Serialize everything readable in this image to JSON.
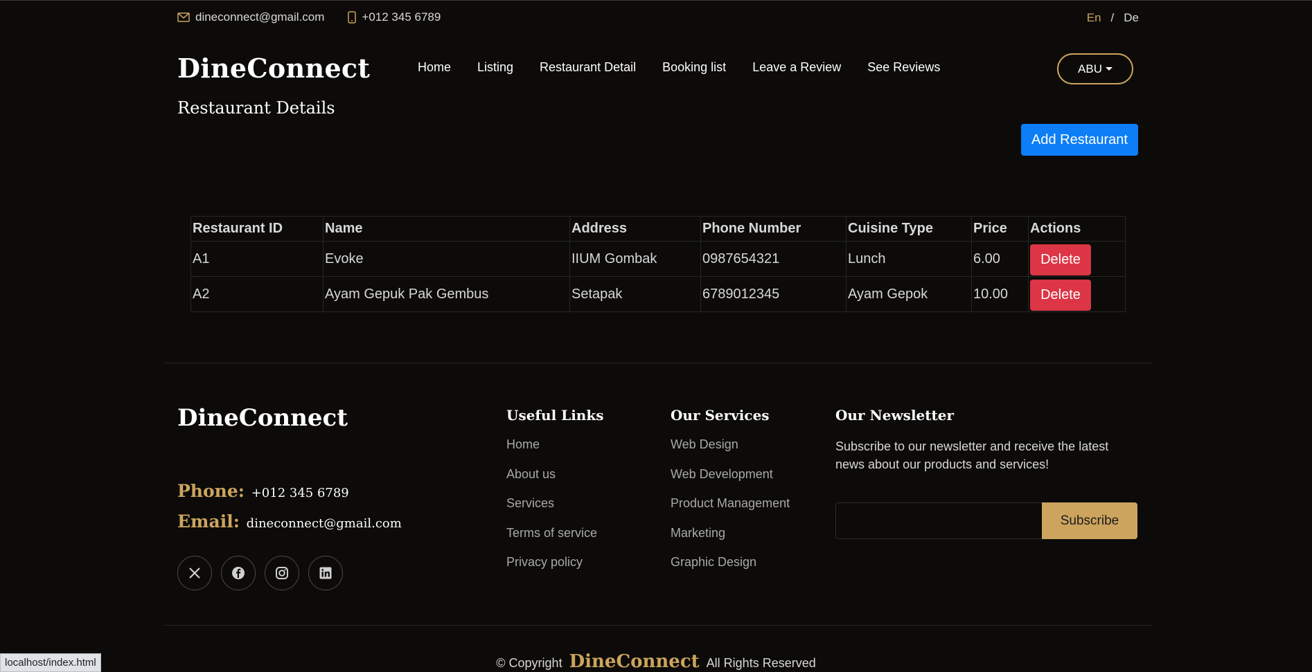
{
  "topbar": {
    "email": "dineconnect@gmail.com",
    "phone": "+012 345 6789",
    "lang_en": "En",
    "lang_sep": "/",
    "lang_de": "De"
  },
  "header": {
    "logo": "DineConnect",
    "nav": [
      "Home",
      "Listing",
      "Restaurant Detail",
      "Booking list",
      "Leave a Review",
      "See Reviews"
    ],
    "user_label": "ABU"
  },
  "main": {
    "title": "Restaurant Details",
    "add_button": "Add Restaurant",
    "columns": [
      "Restaurant ID",
      "Name",
      "Address",
      "Phone Number",
      "Cuisine Type",
      "Price",
      "Actions"
    ],
    "rows": [
      {
        "id": "A1",
        "name": "Evoke",
        "address": "IIUM Gombak",
        "phone": "0987654321",
        "cuisine": "Lunch",
        "price": "6.00",
        "action": "Delete"
      },
      {
        "id": "A2",
        "name": "Ayam Gepuk Pak Gembus",
        "address": "Setapak",
        "phone": "6789012345",
        "cuisine": "Ayam Gepok",
        "price": "10.00",
        "action": "Delete"
      }
    ]
  },
  "footer": {
    "logo": "DineConnect",
    "phone_label": "Phone:",
    "phone_value": "+012 345 6789",
    "email_label": "Email:",
    "email_value": "dineconnect@gmail.com",
    "socials": [
      "x-icon",
      "facebook-icon",
      "instagram-icon",
      "linkedin-icon"
    ],
    "useful_links": {
      "title": "Useful Links",
      "items": [
        "Home",
        "About us",
        "Services",
        "Terms of service",
        "Privacy policy"
      ]
    },
    "services": {
      "title": "Our Services",
      "items": [
        "Web Design",
        "Web Development",
        "Product Management",
        "Marketing",
        "Graphic Design"
      ]
    },
    "newsletter": {
      "title": "Our Newsletter",
      "text": "Subscribe to our newsletter and receive the latest news about our products and services!",
      "placeholder": "",
      "button": "Subscribe"
    },
    "copyright_prefix": "© Copyright",
    "copyright_brand": "DineConnect",
    "copyright_suffix": "All Rights Reserved"
  },
  "statusbar": {
    "url": "localhost/index.html"
  },
  "colors": {
    "accent": "#cda45e",
    "primary": "#0d7ef5",
    "danger": "#dc3545",
    "background": "#0c0b09"
  }
}
